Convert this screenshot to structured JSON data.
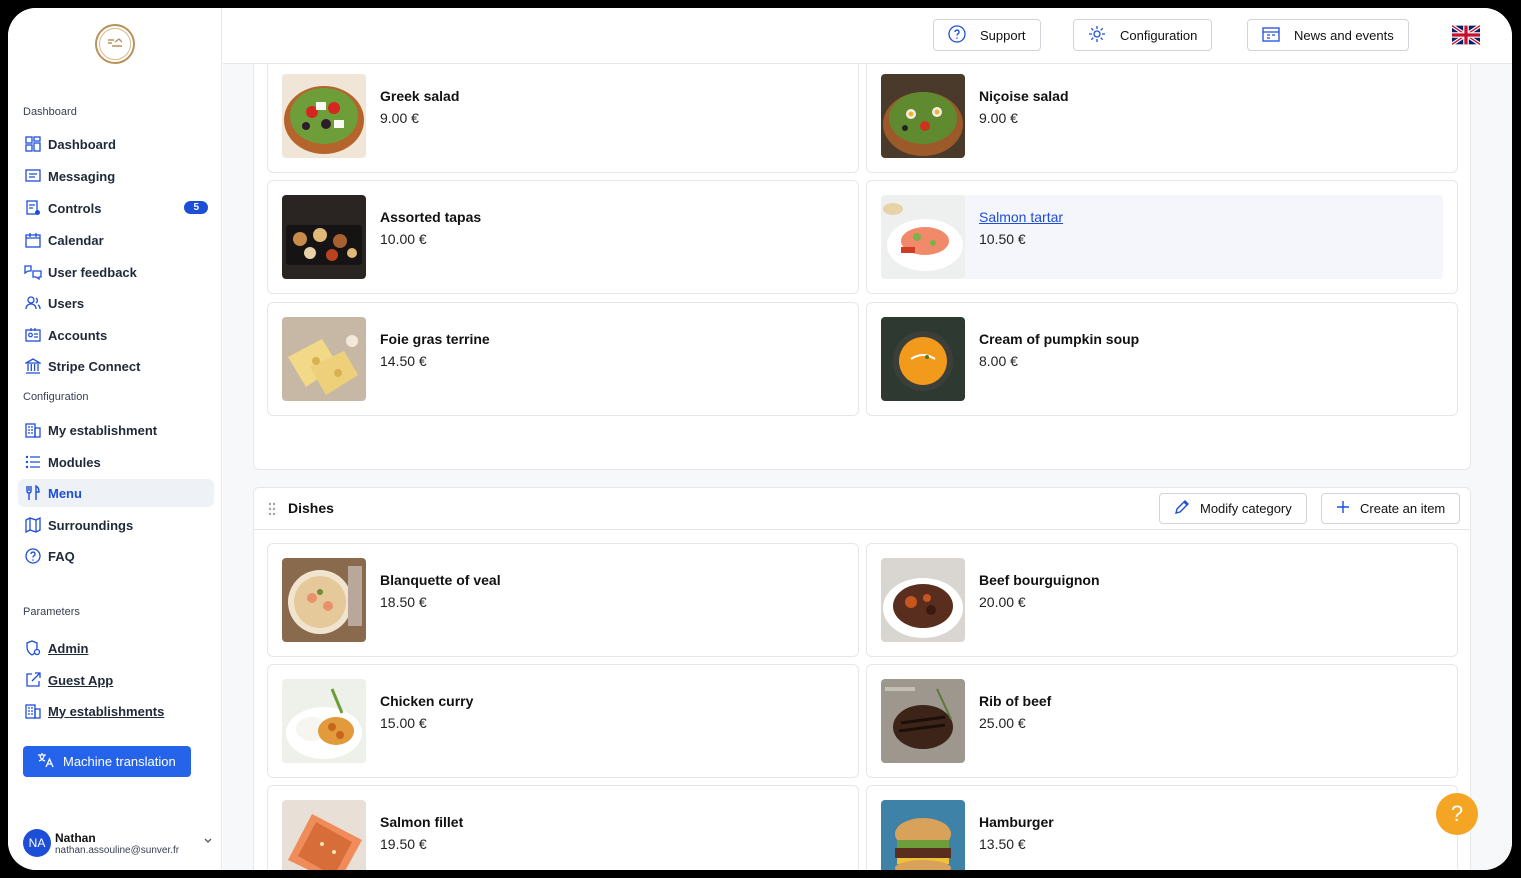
{
  "sidebar": {
    "sections": {
      "dashboard": "Dashboard",
      "configuration": "Configuration",
      "parameters": "Parameters"
    },
    "items": {
      "dashboard": "Dashboard",
      "messaging": "Messaging",
      "controls": "Controls",
      "controls_badge": "5",
      "calendar": "Calendar",
      "user_feedback": "User feedback",
      "users": "Users",
      "accounts": "Accounts",
      "stripe_connect": "Stripe Connect",
      "my_establishment": "My establishment",
      "modules": "Modules",
      "menu": "Menu",
      "surroundings": "Surroundings",
      "faq": "FAQ",
      "admin": "Admin",
      "guest_app": "Guest App",
      "my_establishments": "My establishments"
    },
    "machine_translation": "Machine translation",
    "user": {
      "initials": "NA",
      "name": "Nathan",
      "email": "nathan.assouline@sunver.fr"
    }
  },
  "topbar": {
    "support": "Support",
    "configuration": "Configuration",
    "news_events": "News and events"
  },
  "starters": {
    "items": [
      {
        "name": "Greek salad",
        "price": "9.00 €"
      },
      {
        "name": "Niçoise salad",
        "price": "9.00 €"
      },
      {
        "name": "Assorted tapas",
        "price": "10.00 €"
      },
      {
        "name": "Salmon tartar",
        "price": "10.50 €"
      },
      {
        "name": "Foie gras terrine",
        "price": "14.50 €"
      },
      {
        "name": "Cream of pumpkin soup",
        "price": "8.00 €"
      }
    ]
  },
  "dishes": {
    "title": "Dishes",
    "modify_category": "Modify category",
    "create_item": "Create an item",
    "items": [
      {
        "name": "Blanquette of veal",
        "price": "18.50 €"
      },
      {
        "name": "Beef bourguignon",
        "price": "20.00 €"
      },
      {
        "name": "Chicken curry",
        "price": "15.00 €"
      },
      {
        "name": "Rib of beef",
        "price": "25.00 €"
      },
      {
        "name": "Salmon fillet",
        "price": "19.50 €"
      },
      {
        "name": "Hamburger",
        "price": "13.50 €"
      }
    ]
  },
  "help_label": "?"
}
